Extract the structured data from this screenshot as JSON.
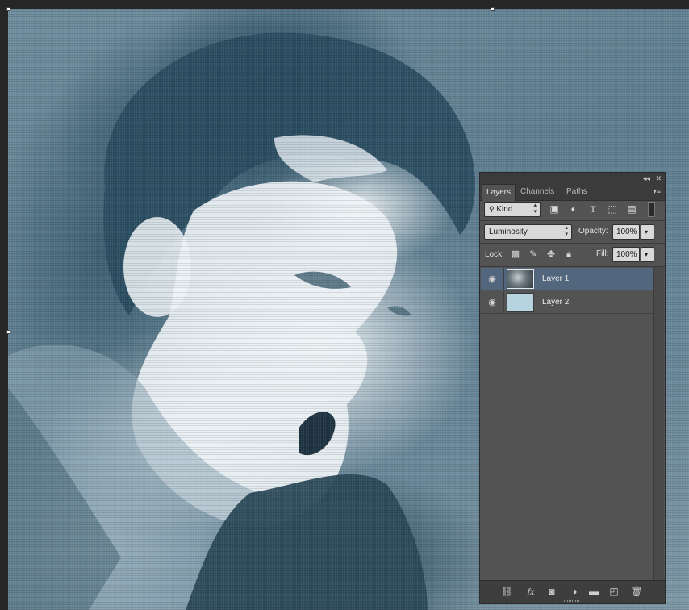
{
  "canvas": {
    "description_colors": {
      "dark": "#2b4a5a",
      "mid": "#6f8d9e",
      "light": "#eef3f6"
    }
  },
  "panel": {
    "collapse_icon": "double-chevron-icon",
    "close_icon": "close-icon",
    "tabs": [
      {
        "label": "Layers",
        "active": true
      },
      {
        "label": "Channels",
        "active": false
      },
      {
        "label": "Paths",
        "active": false
      }
    ],
    "filter": {
      "kind_label": "Kind"
    },
    "blend_mode": "Luminosity",
    "opacity_label": "Opacity:",
    "opacity_value": "100%",
    "lock_label": "Lock:",
    "fill_label": "Fill:",
    "fill_value": "100%",
    "layers": [
      {
        "name": "Layer 1",
        "selected": true,
        "visible": true,
        "thumb_color": "#5a6a72"
      },
      {
        "name": "Layer 2",
        "selected": false,
        "visible": true,
        "thumb_color": "#b8d3e0"
      }
    ],
    "bottom_icons": [
      "link-icon",
      "fx-icon",
      "mask-icon",
      "adjustment-icon",
      "folder-icon",
      "new-layer-icon",
      "trash-icon"
    ]
  },
  "colors": {
    "selected_row": "#52667e",
    "panel_bg": "#535353"
  }
}
